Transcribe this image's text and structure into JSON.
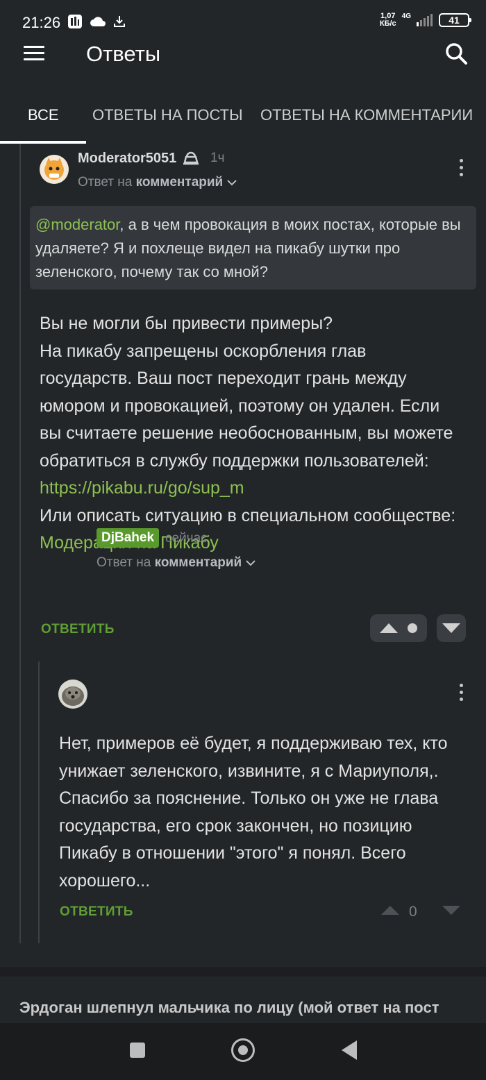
{
  "status_bar": {
    "time": "21:26",
    "speed_value": "1,07",
    "speed_unit": "КБ/с",
    "network": "4G",
    "battery": "41"
  },
  "header": {
    "title": "Ответы",
    "menu_icon": "hamburger-menu-icon",
    "search_icon": "search-icon"
  },
  "tabs": [
    {
      "label": "ВСЕ",
      "active": true
    },
    {
      "label": "ОТВЕТЫ НА ПОСТЫ",
      "active": false
    },
    {
      "label": "ОТВЕТЫ НА КОММЕНТАРИИ",
      "active": false
    }
  ],
  "comment": {
    "username": "Moderator5051",
    "time": "1ч",
    "reply_prefix": "Ответ на",
    "reply_target": "комментарий",
    "quote_mention": "@moderator",
    "quote_text": ", а в чем провокация в моих постах, которые вы удаляете? Я и похлеще видел на пикабу шутки про зеленского, почему так со мной?",
    "body_lines": [
      "Вы не могли бы привести примеры?",
      "На пикабу запрещены оскорбления глав государств. Ваш пост переходит грань между юмором и провокацией, поэтому он удален. Если вы считаете решение необоснованным, вы можете обратиться в службу поддержки пользователей:"
    ],
    "support_link": "https://pikabu.ru/go/sup_m",
    "body_after_link": "Или описать ситуацию в специальном сообществе:",
    "community_link": "Модерация на Пикабу",
    "reply_action": "ОТВЕТИТЬ"
  },
  "reply": {
    "username": "DjBahek",
    "time": "сейчас",
    "reply_prefix": "Ответ на",
    "reply_target": "комментарий",
    "body": "Нет, примеров её будет, я поддерживаю тех, кто унижает зеленского, извините, я с Мариуполя,. Спасибо за пояснение. Только он уже не глава государства, его срок закончен, но позицию Пикабу в отношении \"этого\" я понял. Всего хорошего...",
    "rating": "0",
    "reply_action": "ОТВЕТИТЬ"
  },
  "next_post": {
    "title": "Эрдоган шлепнул мальчика по лицу (мой ответ на пост"
  },
  "colors": {
    "background": "#232629",
    "accent_green": "#8cc051",
    "action_green": "#5f9e35"
  }
}
